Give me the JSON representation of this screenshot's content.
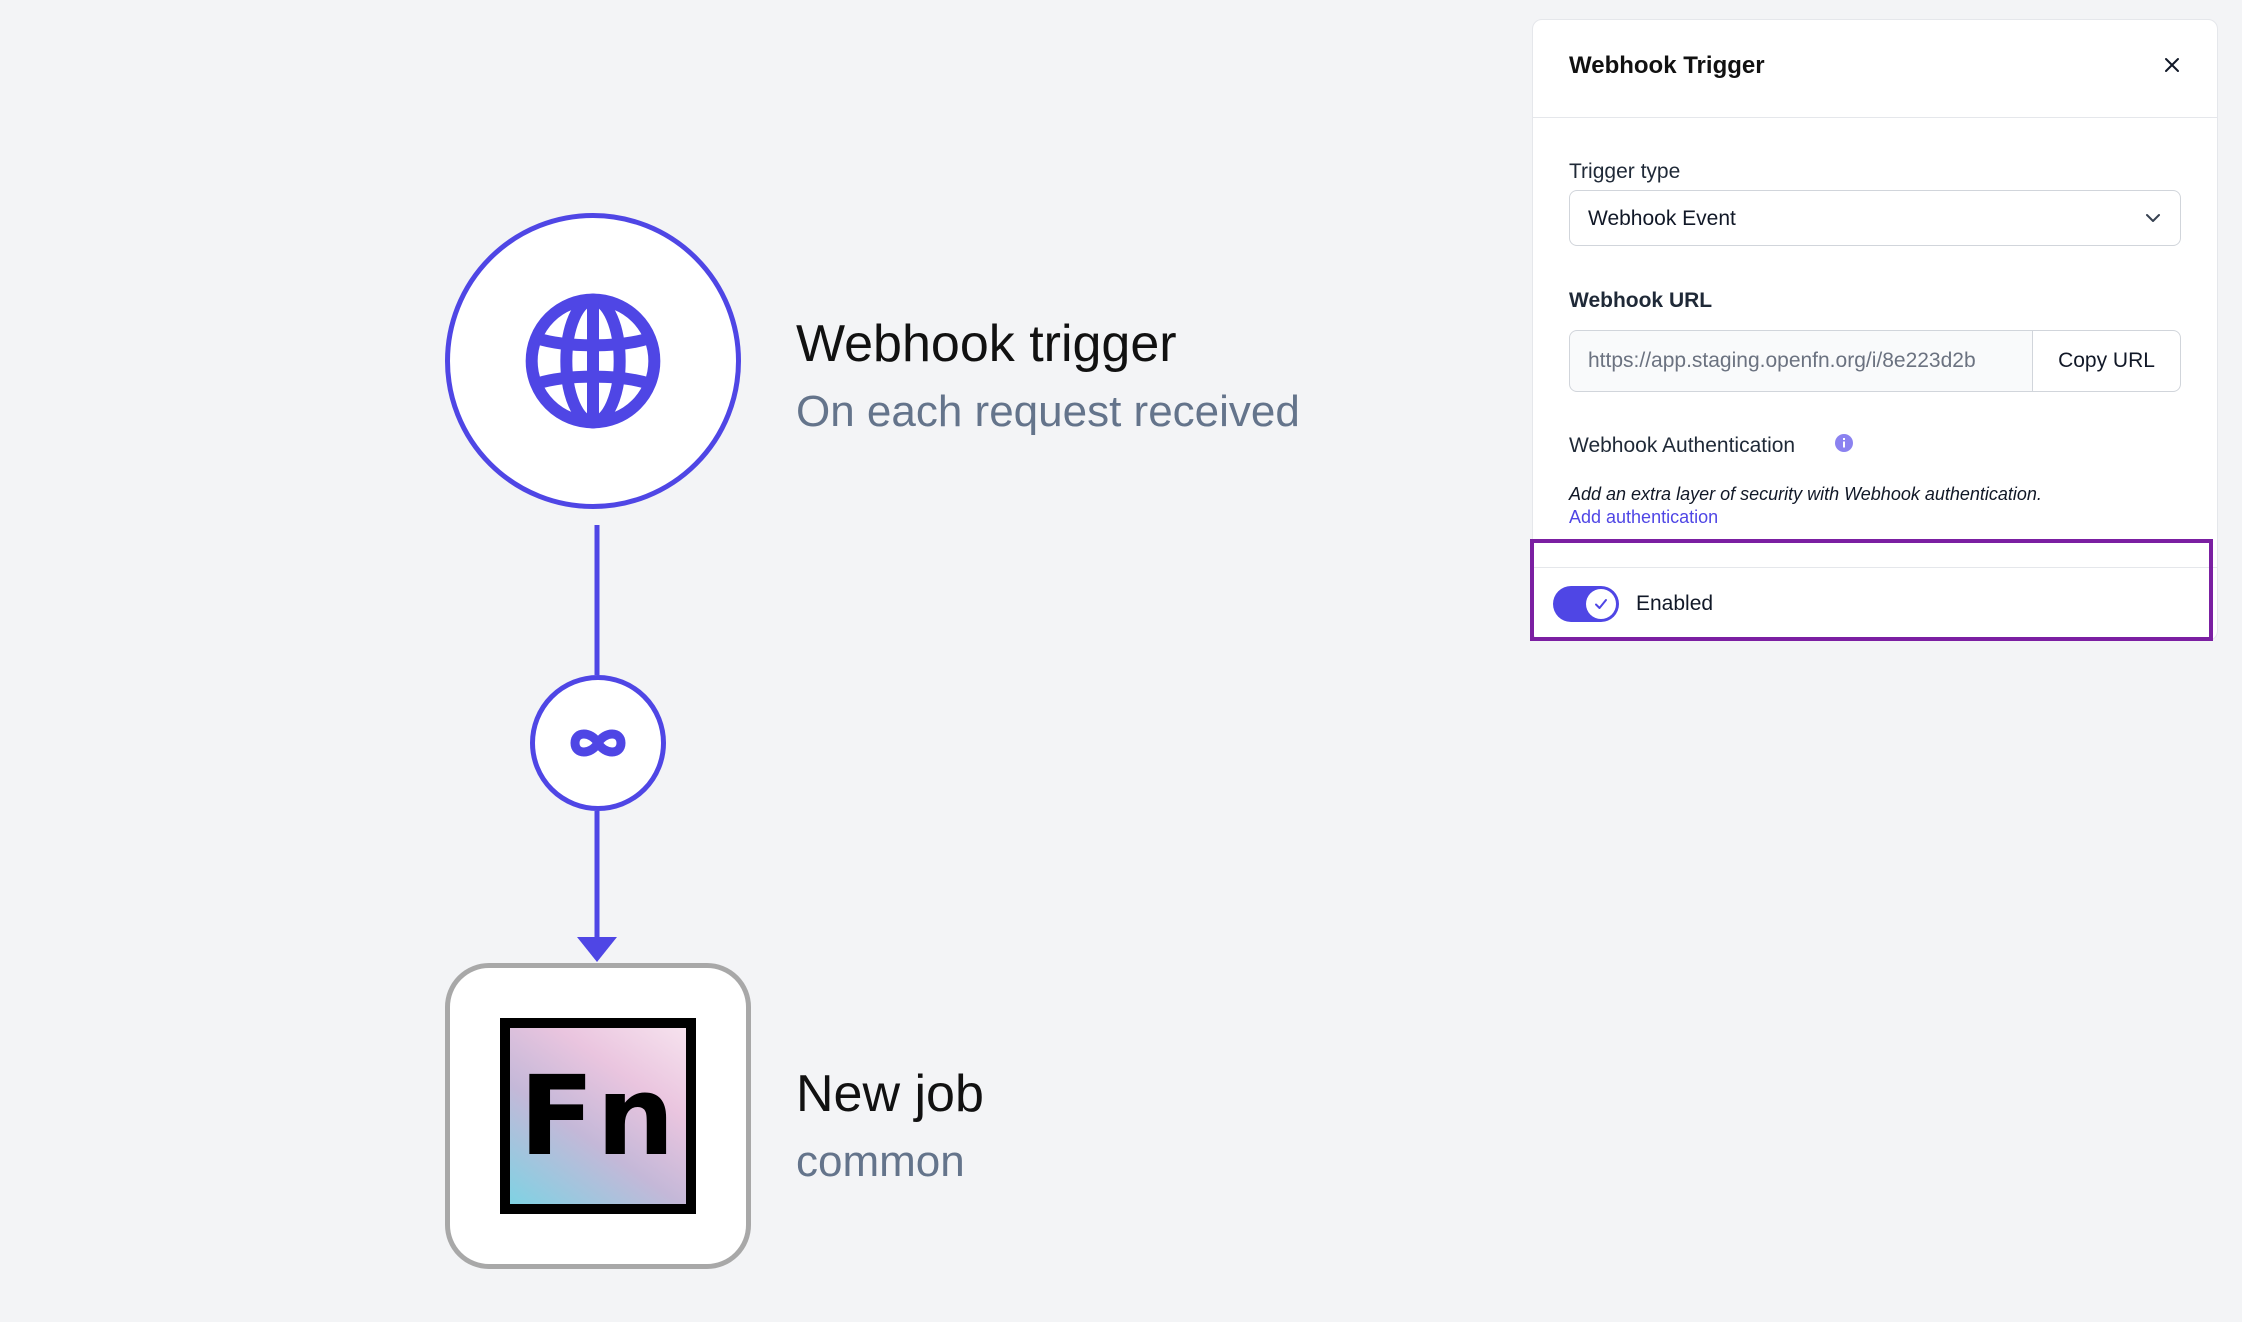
{
  "trigger_node": {
    "icon": "globe-icon",
    "title": "Webhook trigger",
    "subtitle": "On each request received"
  },
  "edge": {
    "icon": "infinity-icon"
  },
  "job_node": {
    "icon_text": "Fn",
    "title": "New job",
    "subtitle": "common"
  },
  "panel": {
    "title": "Webhook Trigger",
    "trigger_type_label": "Trigger type",
    "trigger_type_value": "Webhook Event",
    "webhook_url_label": "Webhook URL",
    "webhook_url_value": "https://app.staging.openfn.org/i/8e223d2b",
    "copy_url_label": "Copy URL",
    "auth_label": "Webhook Authentication",
    "auth_help": "Add an extra layer of security with Webhook authentication.",
    "auth_link": "Add authentication",
    "enabled_label": "Enabled",
    "enabled": true
  },
  "colors": {
    "accent": "#4f46e5",
    "highlight": "#7b1fa2"
  }
}
